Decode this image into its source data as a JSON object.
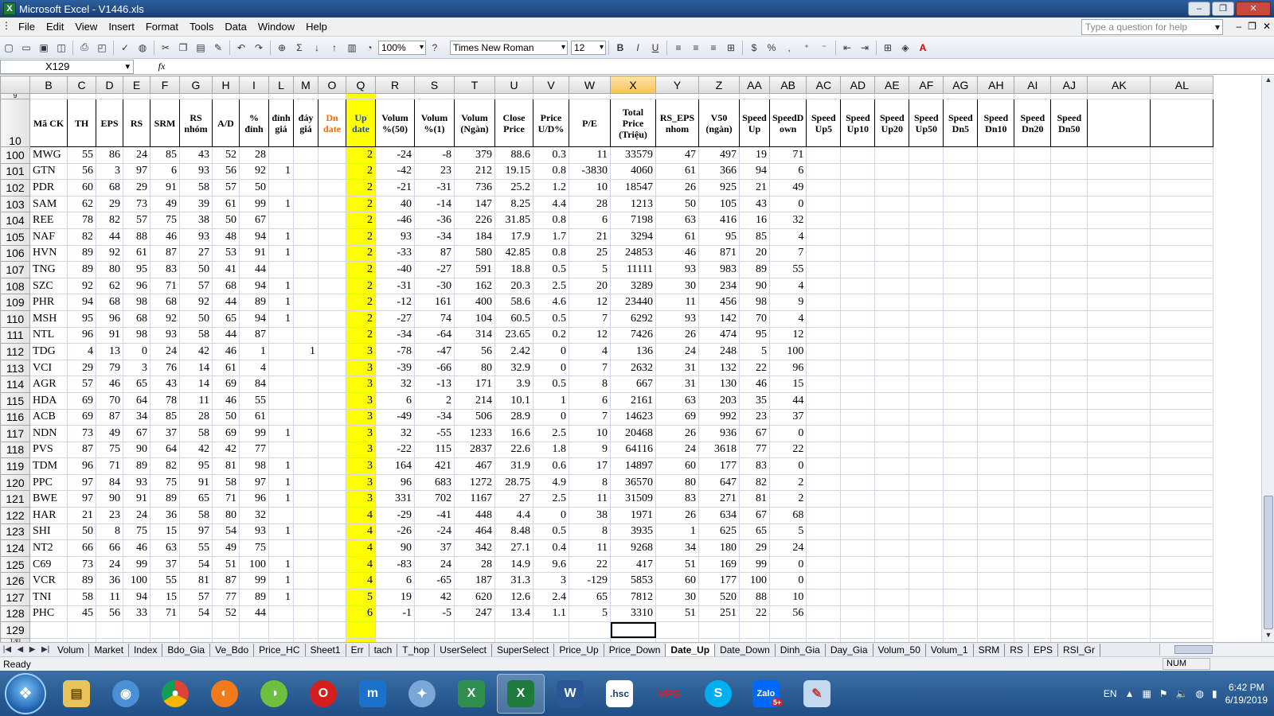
{
  "window": {
    "title": "Microsoft Excel - V1446.xls",
    "app_icon": "X"
  },
  "menu": {
    "items": [
      "File",
      "Edit",
      "View",
      "Insert",
      "Format",
      "Tools",
      "Data",
      "Window",
      "Help"
    ],
    "ask_placeholder": "Type a question for help"
  },
  "toolbar": {
    "zoom": "100%",
    "font": "Times New Roman",
    "font_size": "12",
    "bold": "B",
    "italic": "I",
    "underline": "U",
    "currency": "$",
    "percent": "%",
    "comma": ","
  },
  "formula_bar": {
    "name_box": "X129",
    "fx": "fx",
    "content": ""
  },
  "columns": [
    "B",
    "C",
    "D",
    "E",
    "F",
    "G",
    "H",
    "I",
    "L",
    "M",
    "O",
    "Q",
    "R",
    "S",
    "T",
    "U",
    "V",
    "W",
    "X",
    "Y",
    "Z",
    "AA",
    "AB",
    "AC",
    "AD",
    "AE",
    "AF",
    "AG",
    "AH",
    "AI",
    "AJ",
    "AK",
    "AL"
  ],
  "selected_column": "X",
  "header_row": {
    "row": "10",
    "labels": [
      "Mã CK",
      "TH",
      "EPS",
      "RS",
      "SRM",
      "RS nhóm",
      "A/D",
      "% đỉnh",
      "đỉnh giá",
      "đáy giá",
      "Dn date",
      "Up date",
      "Volum %(50)",
      "Volum %(1)",
      "Volum (Ngàn)",
      "Close Price",
      "Price U/D%",
      "P/E",
      "Total Price (Triệu)",
      "RS_EPS nhom",
      "V50 (ngàn)",
      "Speed Up",
      "SpeedD own",
      "Speed Up5",
      "Speed Up10",
      "Speed Up20",
      "Speed Up50",
      "Speed Dn5",
      "Speed Dn10",
      "Speed Dn20",
      "Speed Dn50",
      "",
      ""
    ]
  },
  "rows": [
    {
      "n": "100",
      "c": [
        "MWG",
        "55",
        "86",
        "24",
        "85",
        "43",
        "52",
        "28",
        "",
        "",
        "",
        "2",
        "-24",
        "-8",
        "379",
        "88.6",
        "0.3",
        "11",
        "33579",
        "47",
        "497",
        "19",
        "71"
      ]
    },
    {
      "n": "101",
      "c": [
        "GTN",
        "56",
        "3",
        "97",
        "6",
        "93",
        "56",
        "92",
        "1",
        "",
        "",
        "2",
        "-42",
        "23",
        "212",
        "19.15",
        "0.8",
        "-3830",
        "4060",
        "61",
        "366",
        "94",
        "6"
      ]
    },
    {
      "n": "102",
      "c": [
        "PDR",
        "60",
        "68",
        "29",
        "91",
        "58",
        "57",
        "50",
        "",
        "",
        "",
        "2",
        "-21",
        "-31",
        "736",
        "25.2",
        "1.2",
        "10",
        "18547",
        "26",
        "925",
        "21",
        "49"
      ]
    },
    {
      "n": "103",
      "c": [
        "SAM",
        "62",
        "29",
        "73",
        "49",
        "39",
        "61",
        "99",
        "1",
        "",
        "",
        "2",
        "40",
        "-14",
        "147",
        "8.25",
        "4.4",
        "28",
        "1213",
        "50",
        "105",
        "43",
        "0"
      ]
    },
    {
      "n": "104",
      "c": [
        "REE",
        "78",
        "82",
        "57",
        "75",
        "38",
        "50",
        "67",
        "",
        "",
        "",
        "2",
        "-46",
        "-36",
        "226",
        "31.85",
        "0.8",
        "6",
        "7198",
        "63",
        "416",
        "16",
        "32"
      ]
    },
    {
      "n": "105",
      "c": [
        "NAF",
        "82",
        "44",
        "88",
        "46",
        "93",
        "48",
        "94",
        "1",
        "",
        "",
        "2",
        "93",
        "-34",
        "184",
        "17.9",
        "1.7",
        "21",
        "3294",
        "61",
        "95",
        "85",
        "4"
      ]
    },
    {
      "n": "106",
      "c": [
        "HVN",
        "89",
        "92",
        "61",
        "87",
        "27",
        "53",
        "91",
        "1",
        "",
        "",
        "2",
        "-33",
        "87",
        "580",
        "42.85",
        "0.8",
        "25",
        "24853",
        "46",
        "871",
        "20",
        "7"
      ]
    },
    {
      "n": "107",
      "c": [
        "TNG",
        "89",
        "80",
        "95",
        "83",
        "50",
        "41",
        "44",
        "",
        "",
        "",
        "2",
        "-40",
        "-27",
        "591",
        "18.8",
        "0.5",
        "5",
        "11111",
        "93",
        "983",
        "89",
        "55"
      ]
    },
    {
      "n": "108",
      "c": [
        "SZC",
        "92",
        "62",
        "96",
        "71",
        "57",
        "68",
        "94",
        "1",
        "",
        "",
        "2",
        "-31",
        "-30",
        "162",
        "20.3",
        "2.5",
        "20",
        "3289",
        "30",
        "234",
        "90",
        "4"
      ]
    },
    {
      "n": "109",
      "c": [
        "PHR",
        "94",
        "68",
        "98",
        "68",
        "92",
        "44",
        "89",
        "1",
        "",
        "",
        "2",
        "-12",
        "161",
        "400",
        "58.6",
        "4.6",
        "12",
        "23440",
        "11",
        "456",
        "98",
        "9"
      ]
    },
    {
      "n": "110",
      "c": [
        "MSH",
        "95",
        "96",
        "68",
        "92",
        "50",
        "65",
        "94",
        "1",
        "",
        "",
        "2",
        "-27",
        "74",
        "104",
        "60.5",
        "0.5",
        "7",
        "6292",
        "93",
        "142",
        "70",
        "4"
      ]
    },
    {
      "n": "111",
      "c": [
        "NTL",
        "96",
        "91",
        "98",
        "93",
        "58",
        "44",
        "87",
        "",
        "",
        "",
        "2",
        "-34",
        "-64",
        "314",
        "23.65",
        "0.2",
        "12",
        "7426",
        "26",
        "474",
        "95",
        "12"
      ]
    },
    {
      "n": "112",
      "c": [
        "TDG",
        "4",
        "13",
        "0",
        "24",
        "42",
        "46",
        "1",
        "",
        "1",
        "",
        "3",
        "-78",
        "-47",
        "56",
        "2.42",
        "0",
        "4",
        "136",
        "24",
        "248",
        "5",
        "100"
      ]
    },
    {
      "n": "113",
      "c": [
        "VCI",
        "29",
        "79",
        "3",
        "76",
        "14",
        "61",
        "4",
        "",
        "",
        "",
        "3",
        "-39",
        "-66",
        "80",
        "32.9",
        "0",
        "7",
        "2632",
        "31",
        "132",
        "22",
        "96"
      ]
    },
    {
      "n": "114",
      "c": [
        "AGR",
        "57",
        "46",
        "65",
        "43",
        "14",
        "69",
        "84",
        "",
        "",
        "",
        "3",
        "32",
        "-13",
        "171",
        "3.9",
        "0.5",
        "8",
        "667",
        "31",
        "130",
        "46",
        "15"
      ]
    },
    {
      "n": "115",
      "c": [
        "HDA",
        "69",
        "70",
        "64",
        "78",
        "11",
        "46",
        "55",
        "",
        "",
        "",
        "3",
        "6",
        "2",
        "214",
        "10.1",
        "1",
        "6",
        "2161",
        "63",
        "203",
        "35",
        "44"
      ]
    },
    {
      "n": "116",
      "c": [
        "ACB",
        "69",
        "87",
        "34",
        "85",
        "28",
        "50",
        "61",
        "",
        "",
        "",
        "3",
        "-49",
        "-34",
        "506",
        "28.9",
        "0",
        "7",
        "14623",
        "69",
        "992",
        "23",
        "37"
      ]
    },
    {
      "n": "117",
      "c": [
        "NDN",
        "73",
        "49",
        "67",
        "37",
        "58",
        "69",
        "99",
        "1",
        "",
        "",
        "3",
        "32",
        "-55",
        "1233",
        "16.6",
        "2.5",
        "10",
        "20468",
        "26",
        "936",
        "67",
        "0"
      ]
    },
    {
      "n": "118",
      "c": [
        "PVS",
        "87",
        "75",
        "90",
        "64",
        "42",
        "42",
        "77",
        "",
        "",
        "",
        "3",
        "-22",
        "115",
        "2837",
        "22.6",
        "1.8",
        "9",
        "64116",
        "24",
        "3618",
        "77",
        "22"
      ]
    },
    {
      "n": "119",
      "c": [
        "TDM",
        "96",
        "71",
        "89",
        "82",
        "95",
        "81",
        "98",
        "1",
        "",
        "",
        "3",
        "164",
        "421",
        "467",
        "31.9",
        "0.6",
        "17",
        "14897",
        "60",
        "177",
        "83",
        "0"
      ]
    },
    {
      "n": "120",
      "c": [
        "PPC",
        "97",
        "84",
        "93",
        "75",
        "91",
        "58",
        "97",
        "1",
        "",
        "",
        "3",
        "96",
        "683",
        "1272",
        "28.75",
        "4.9",
        "8",
        "36570",
        "80",
        "647",
        "82",
        "2"
      ]
    },
    {
      "n": "121",
      "c": [
        "BWE",
        "97",
        "90",
        "91",
        "89",
        "65",
        "71",
        "96",
        "1",
        "",
        "",
        "3",
        "331",
        "702",
        "1167",
        "27",
        "2.5",
        "11",
        "31509",
        "83",
        "271",
        "81",
        "2"
      ]
    },
    {
      "n": "122",
      "c": [
        "HAR",
        "21",
        "23",
        "24",
        "36",
        "58",
        "80",
        "32",
        "",
        "",
        "",
        "4",
        "-29",
        "-41",
        "448",
        "4.4",
        "0",
        "38",
        "1971",
        "26",
        "634",
        "67",
        "68"
      ]
    },
    {
      "n": "123",
      "c": [
        "SHI",
        "50",
        "8",
        "75",
        "15",
        "97",
        "54",
        "93",
        "1",
        "",
        "",
        "4",
        "-26",
        "-24",
        "464",
        "8.48",
        "0.5",
        "8",
        "3935",
        "1",
        "625",
        "65",
        "5"
      ]
    },
    {
      "n": "124",
      "c": [
        "NT2",
        "66",
        "66",
        "46",
        "63",
        "55",
        "49",
        "75",
        "",
        "",
        "",
        "4",
        "90",
        "37",
        "342",
        "27.1",
        "0.4",
        "11",
        "9268",
        "34",
        "180",
        "29",
        "24"
      ]
    },
    {
      "n": "125",
      "c": [
        "C69",
        "73",
        "24",
        "99",
        "37",
        "54",
        "51",
        "100",
        "1",
        "",
        "",
        "4",
        "-83",
        "24",
        "28",
        "14.9",
        "9.6",
        "22",
        "417",
        "51",
        "169",
        "99",
        "0"
      ]
    },
    {
      "n": "126",
      "c": [
        "VCR",
        "89",
        "36",
        "100",
        "55",
        "81",
        "87",
        "99",
        "1",
        "",
        "",
        "4",
        "6",
        "-65",
        "187",
        "31.3",
        "3",
        "-129",
        "5853",
        "60",
        "177",
        "100",
        "0"
      ]
    },
    {
      "n": "127",
      "c": [
        "TNI",
        "58",
        "11",
        "94",
        "15",
        "57",
        "77",
        "89",
        "1",
        "",
        "",
        "5",
        "19",
        "42",
        "620",
        "12.6",
        "2.4",
        "65",
        "7812",
        "30",
        "520",
        "88",
        "10"
      ]
    },
    {
      "n": "128",
      "c": [
        "PHC",
        "45",
        "56",
        "33",
        "71",
        "54",
        "52",
        "44",
        "",
        "",
        "",
        "6",
        "-1",
        "-5",
        "247",
        "13.4",
        "1.1",
        "5",
        "3310",
        "51",
        "251",
        "22",
        "56"
      ]
    },
    {
      "n": "129",
      "c": []
    }
  ],
  "top_partial_row": "9",
  "bottom_partial_row": "130",
  "sheet_tabs": [
    "Volum",
    "Market",
    "Index",
    "Bdo_Gia",
    "Ve_Bdo",
    "Price_HC",
    "Sheet1",
    "Err",
    "tach",
    "T_hop",
    "UserSelect",
    "SuperSelect",
    "Price_Up",
    "Price_Down",
    "Date_Up",
    "Date_Down",
    "Dinh_Gia",
    "Day_Gia",
    "Volum_50",
    "Volum_1",
    "SRM",
    "RS",
    "EPS",
    "RSI_Gr"
  ],
  "active_tab": "Date_Up",
  "status": {
    "left": "Ready",
    "num": "NUM"
  },
  "taskbar": {
    "apps": [
      "file-explorer",
      "chrome-blue",
      "chrome",
      "firefox",
      "coccoc",
      "opera",
      "mobile-app",
      "safari",
      "excel-2007",
      "excel",
      "word",
      "hsc",
      "vps",
      "skype",
      "zalo",
      "paint"
    ],
    "lang": "EN",
    "time": "6:42 PM",
    "date": "6/19/2019",
    "zalo_badge": "5+"
  },
  "colors": {
    "highlight_yellow": "#ffff00",
    "dn_date_orange": "#ff6a00",
    "up_date_blue": "#1f3fd8",
    "title_bar": "#1c3f73"
  }
}
